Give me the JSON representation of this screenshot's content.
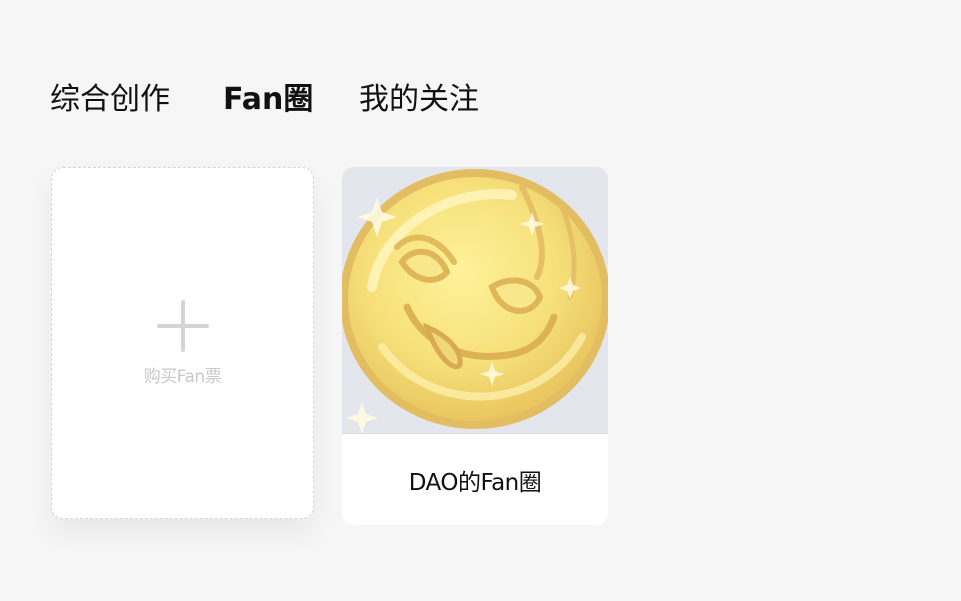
{
  "tabs": [
    {
      "label": "综合创作",
      "active": false
    },
    {
      "label": "Fan圈",
      "active": true
    },
    {
      "label": "我的关注",
      "active": false
    }
  ],
  "buy_card": {
    "icon": "plus-icon",
    "label": "购买Fan票"
  },
  "fan_circles": [
    {
      "name": "DAO的Fan圈",
      "cover_icon": "gold-coin-face-icon"
    }
  ]
}
